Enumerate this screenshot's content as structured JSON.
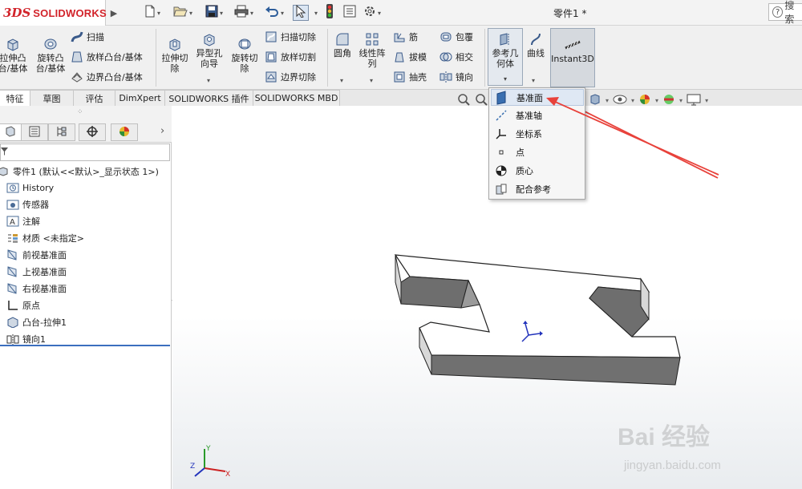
{
  "app": {
    "logo_mark": "3DS",
    "logo_text": "SOLIDWORKS",
    "document_title": "零件1 *",
    "search_placeholder": "搜索"
  },
  "quick_access": {
    "icons": [
      "new-icon",
      "open-icon",
      "save-icon",
      "print-icon",
      "undo-icon",
      "select-icon",
      "traffic-light-icon",
      "file-properties-icon",
      "options-gear-icon"
    ]
  },
  "ribbon": {
    "extrude_boss": "拉伸凸台/基体",
    "revolve_boss": "旋转凸台/基体",
    "sweep": "扫描",
    "loft_boss": "放样凸台/基体",
    "boundary_boss": "边界凸台/基体",
    "extrude_cut": "拉伸切除",
    "hole_wizard": "异型孔向导",
    "revolve_cut": "旋转切除",
    "swept_cut": "扫描切除",
    "lofted_cut": "放样切割",
    "boundary_cut": "边界切除",
    "fillet": "圆角",
    "linear_pattern": "线性阵列",
    "rib": "筋",
    "draft": "拔模",
    "shell": "抽壳",
    "wrap": "包覆",
    "intersect": "相交",
    "mirror": "镜向",
    "ref_geometry": "参考几何体",
    "curves": "曲线",
    "instant3d": "Instant3D"
  },
  "tabs": [
    "特征",
    "草图",
    "评估",
    "DimXpert",
    "SOLIDWORKS 插件",
    "SOLIDWORKS MBD"
  ],
  "tree": {
    "root": "零件1 (默认<<默认>_显示状态 1>)",
    "items": [
      "History",
      "传感器",
      "注解",
      "材质 <未指定>",
      "前视基准面",
      "上视基准面",
      "右视基准面",
      "原点",
      "凸台-拉伸1",
      "镜向1"
    ]
  },
  "ref_menu": {
    "items": [
      "基准面",
      "基准轴",
      "坐标系",
      "点",
      "质心",
      "配合参考"
    ],
    "highlighted_index": 0
  },
  "axes": {
    "x": "X",
    "y": "Y",
    "z": "Z"
  },
  "watermark": {
    "main": "Bai 经验",
    "sub": "jingyan.baidu.com"
  },
  "colors": {
    "brand": "#d2232a",
    "highlight": "#dfe8f4",
    "arrow": "#e8413a"
  }
}
